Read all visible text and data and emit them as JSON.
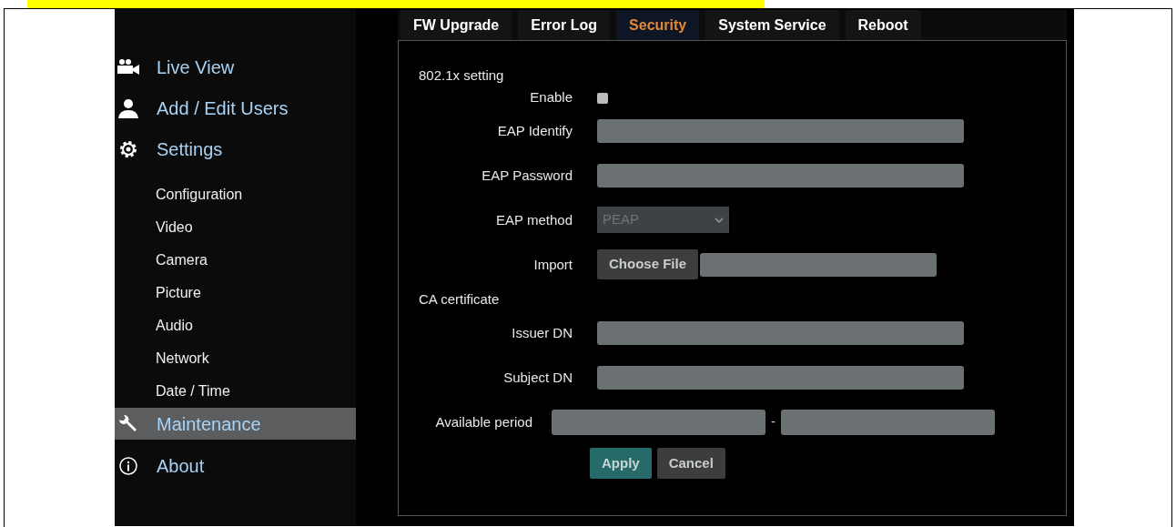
{
  "tabs": [
    {
      "label": "FW Upgrade",
      "selected": false
    },
    {
      "label": "Error Log",
      "selected": false
    },
    {
      "label": "Security",
      "selected": true
    },
    {
      "label": "System Service",
      "selected": false
    },
    {
      "label": "Reboot",
      "selected": false
    }
  ],
  "sidebar": {
    "items": [
      {
        "kind": "main",
        "label": "Live View",
        "selected": false
      },
      {
        "kind": "main",
        "label": "Add / Edit Users",
        "selected": false
      },
      {
        "kind": "main",
        "label": "Settings",
        "selected": false
      },
      {
        "kind": "sub",
        "label": "Configuration",
        "selected": false
      },
      {
        "kind": "sub",
        "label": "Video",
        "selected": false
      },
      {
        "kind": "sub",
        "label": "Camera",
        "selected": false
      },
      {
        "kind": "sub",
        "label": "Picture",
        "selected": false
      },
      {
        "kind": "sub",
        "label": "Audio",
        "selected": false
      },
      {
        "kind": "sub",
        "label": "Network",
        "selected": false
      },
      {
        "kind": "sub",
        "label": "Date / Time",
        "selected": false
      },
      {
        "kind": "main",
        "label": "Maintenance",
        "selected": true
      },
      {
        "kind": "main",
        "label": "About",
        "selected": false
      }
    ]
  },
  "sections": [
    {
      "title": "802.1x setting",
      "rows": [
        {
          "kind": "checkbox",
          "label": "Enable",
          "checked": false
        },
        {
          "kind": "text",
          "label": "EAP Identify"
        },
        {
          "kind": "text",
          "label": "EAP Password"
        },
        {
          "kind": "select",
          "label": "EAP method",
          "value": "PEAP"
        },
        {
          "kind": "file",
          "label": "Import",
          "button": "Choose File"
        }
      ]
    },
    {
      "title": "CA certificate",
      "rows": [
        {
          "kind": "text",
          "label": "Issuer DN"
        },
        {
          "kind": "text",
          "label": "Subject DN"
        },
        {
          "kind": "range",
          "label": "Available period",
          "separator": "-"
        }
      ]
    }
  ],
  "buttons": [
    {
      "kind": "primary",
      "label": "Apply"
    },
    {
      "kind": "secondary",
      "label": "Cancel"
    }
  ]
}
